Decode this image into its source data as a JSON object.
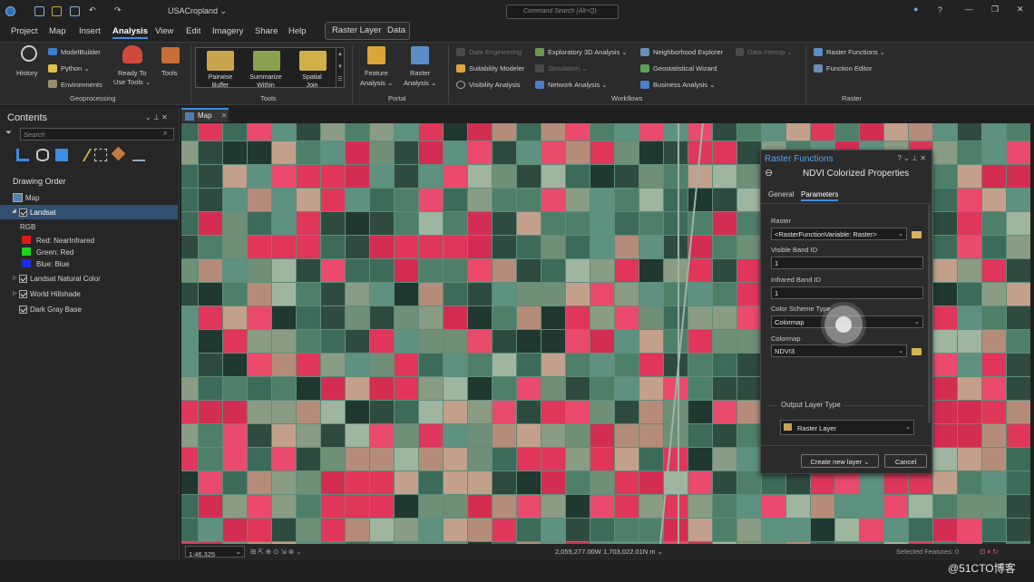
{
  "titlebar": {
    "project": "USACropland ⌄",
    "command_search": "Command Search (Alt+Q)"
  },
  "menu": {
    "items": [
      "Project",
      "Map",
      "Insert",
      "Analysis",
      "View",
      "Edit",
      "Imagery",
      "Share",
      "Help"
    ],
    "context": [
      "Raster Layer",
      "Data"
    ]
  },
  "ribbon": {
    "geoprocessing": {
      "history": "History",
      "modelbuilder": "ModelBuilder",
      "python": "Python ⌄",
      "environments": "Environments",
      "ready1": "Ready To",
      "ready2": "Use Tools ⌄",
      "tools": "Tools",
      "group": "Geoprocessing"
    },
    "tools": {
      "pairwise1": "Pairwise",
      "pairwise2": "Buffer",
      "summarize1": "Summarize",
      "summarize2": "Within",
      "spatial1": "Spatial",
      "spatial2": "Join",
      "group": "Tools"
    },
    "portal": {
      "feature1": "Feature",
      "feature2": "Analysis ⌄",
      "raster1": "Raster",
      "raster2": "Analysis ⌄",
      "group": "Portal"
    },
    "workflows": {
      "data_eng": "Data Engineering",
      "suitability": "Suitability Modeler",
      "visibility": "Visibility Analysis",
      "explore3d": "Exploratory 3D Analysis ⌄",
      "simulation": "Simulation ⌄",
      "network": "Network Analysis ⌄",
      "neighborhood": "Neighborhood Explorer",
      "geostat": "Geostatistical Wizard",
      "business": "Business Analysis ⌄",
      "interop": "Data Interop ⌄",
      "group": "Workflows"
    },
    "raster": {
      "functions": "Raster Functions ⌄",
      "editor": "Function Editor",
      "group": "Raster"
    }
  },
  "contents": {
    "title": "Contents",
    "search_placeholder": "Search",
    "drawing_order": "Drawing Order",
    "map": "Map",
    "landsat": "Landsat",
    "rgb": "RGB",
    "red": "Red:  NearInfrared",
    "green": "Green: Red",
    "blue": "Blue:  Blue",
    "natural": "Landsat Natural Color",
    "hillshade": "World Hillshade",
    "darkgray": "Dark Gray Base"
  },
  "map_tab": "Map",
  "status": {
    "scale": "1:46,325",
    "coords": "2,055,277.00W 1,703,022.01N m ⌄",
    "selected": "Selected Features: 0"
  },
  "dialog": {
    "header": "Raster Functions",
    "title": "NDVI Colorized Properties",
    "tab_general": "General",
    "tab_params": "Parameters",
    "raster_label": "Raster",
    "raster_value": "<RasterFunctionVariable: Raster>",
    "visible_label": "Visible Band ID",
    "visible_value": "1",
    "infrared_label": "Infrared Band ID",
    "infrared_value": "1",
    "scheme_label": "Color Scheme Type",
    "scheme_value": "Colormap",
    "colormap_label": "Colormap",
    "colormap_value": "NDVI3",
    "output_label": "Output Layer Type",
    "output_value": "Raster Layer",
    "create_btn": "Create new layer ⌄",
    "cancel_btn": "Cancel"
  },
  "watermark": "@51CTO博客",
  "colors": {
    "accent": "#3b8ee0",
    "field_red": "#e0365a",
    "field_green": "#4e7f69"
  }
}
